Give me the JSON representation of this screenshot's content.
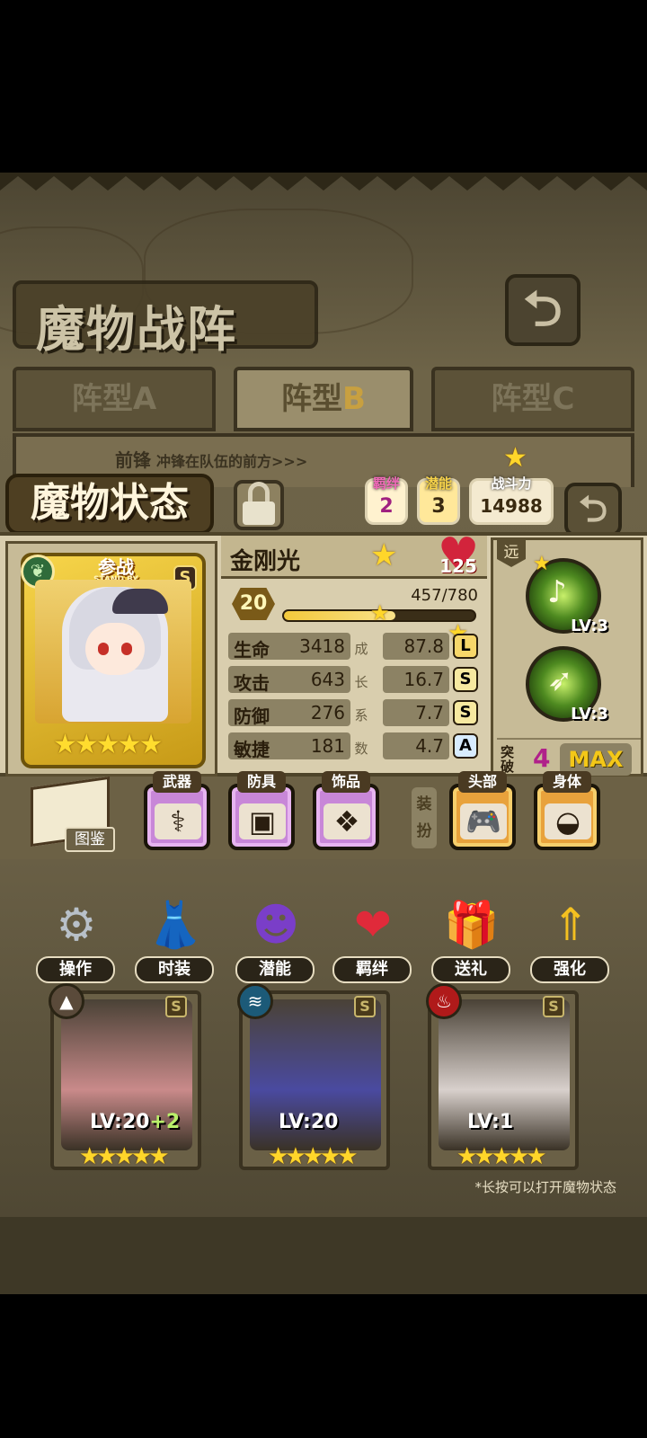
{
  "header": {
    "title": "魔物战阵",
    "back_icon": "back-arrow-icon"
  },
  "formation_tabs": [
    {
      "prefix": "阵型",
      "letter": "A",
      "active": false
    },
    {
      "prefix": "阵型",
      "letter": "B",
      "active": true
    },
    {
      "prefix": "阵型",
      "letter": "C",
      "active": false
    }
  ],
  "vanguard": {
    "title": "前锋",
    "desc": "冲锋在队伍的前方>>>"
  },
  "status": {
    "title": "魔物状态",
    "bond": {
      "label": "羁绊",
      "value": "2"
    },
    "potential": {
      "label": "潜能",
      "value": "3"
    },
    "power": {
      "label": "战斗力",
      "value": "14988"
    }
  },
  "monster": {
    "standby_label": "参战",
    "standby_en": "STAND BY",
    "rank": "S",
    "name": "金刚光",
    "affection": "125",
    "level": "20",
    "exp": "457/780",
    "exp_progress": 0.586,
    "stars": "★★★★★",
    "stats": [
      {
        "label": "生命",
        "value": "3418",
        "growth": "87.8",
        "grade": "L"
      },
      {
        "label": "攻击",
        "value": "643",
        "growth": "16.7",
        "grade": "S"
      },
      {
        "label": "防御",
        "value": "276",
        "growth": "7.7",
        "grade": "S"
      },
      {
        "label": "敏捷",
        "value": "181",
        "growth": "4.7",
        "grade": "A"
      }
    ],
    "growth_vertical": [
      "成",
      "长",
      "系",
      "数"
    ],
    "range_label": "远",
    "skills": [
      {
        "lv": "LV:3"
      },
      {
        "lv": "LV:3"
      }
    ],
    "breakthrough": {
      "label": "突破",
      "value": "4",
      "max_label": "MAX"
    }
  },
  "equipment": {
    "dict_label": "图鉴",
    "slots": [
      {
        "label": "武器",
        "icon": "staff-icon",
        "glyph": "⚕"
      },
      {
        "label": "防具",
        "icon": "box-icon",
        "glyph": "▣"
      },
      {
        "label": "饰品",
        "icon": "tablet-icon",
        "glyph": "❖"
      }
    ],
    "dress_label": "装扮",
    "dress_slots": [
      {
        "label": "头部",
        "icon": "gamepad-icon",
        "glyph": "🎮"
      },
      {
        "label": "身体",
        "icon": "pillow-icon",
        "glyph": "◒"
      }
    ]
  },
  "menu": [
    {
      "label": "操作",
      "icon": "gear-icon",
      "glyph": "⚙",
      "color": "#b8c0c8"
    },
    {
      "label": "时装",
      "icon": "outfit-icon",
      "glyph": "👗",
      "color": "#f2a0d8"
    },
    {
      "label": "潜能",
      "icon": "devil-icon",
      "glyph": "☻",
      "color": "#7a3ec8"
    },
    {
      "label": "羁绊",
      "icon": "hearts-icon",
      "glyph": "❤",
      "color": "#e02a3a"
    },
    {
      "label": "送礼",
      "icon": "gift-icon",
      "glyph": "🎁",
      "color": "#e85ab8"
    },
    {
      "label": "强化",
      "icon": "upgrade-arrows-icon",
      "glyph": "⇑",
      "color": "#f4c020"
    }
  ],
  "team": [
    {
      "lv": "LV:20",
      "plus": "+2",
      "stars": "★★★★★",
      "rank": "S",
      "elem_color": "#5a4a3a",
      "elem_glyph": "▲",
      "art_color": "#c98a8a"
    },
    {
      "lv": "LV:20",
      "plus": "",
      "stars": "★★★★★",
      "rank": "S",
      "elem_color": "#1c5a78",
      "elem_glyph": "≋",
      "art_color": "#4a4aa0"
    },
    {
      "lv": "LV:1",
      "plus": "",
      "stars": "★★★★★",
      "rank": "S",
      "elem_color": "#b01a1a",
      "elem_glyph": "♨",
      "art_color": "#d8d0cc"
    }
  ],
  "hint": "*长按可以打开魔物状态"
}
